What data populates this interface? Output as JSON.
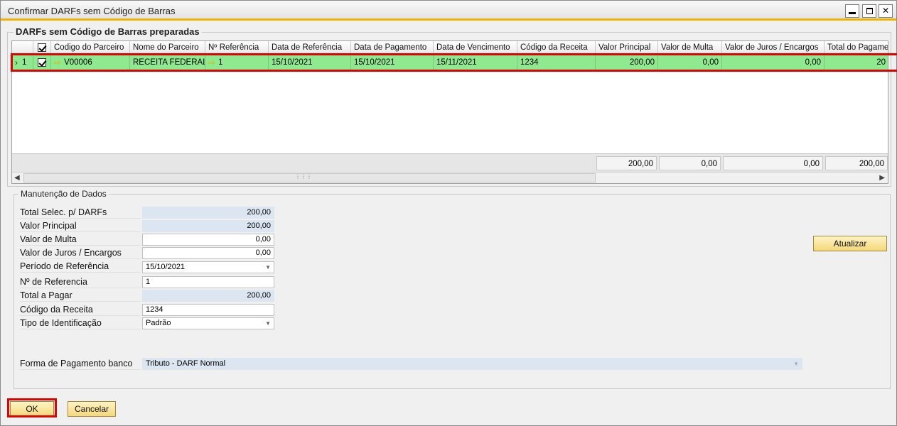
{
  "window": {
    "title": "Confirmar DARFs sem Código de Barras"
  },
  "grid": {
    "group_title": "DARFs sem Código de Barras preparadas",
    "columns": [
      "Codigo do Parceiro",
      "Nome do Parceiro",
      "Nº Referência",
      "Data de Referência",
      "Data de Pagamento",
      "Data de Vencimento",
      "Código da Receita",
      "Valor Principal",
      "Valor de Multa",
      "Valor de Juros / Encargos",
      "Total do Pagamen"
    ],
    "row": {
      "index": "1",
      "codigo_parceiro": "V00006",
      "nome_parceiro": "RECEITA FEDERAL",
      "referencia": "1",
      "data_referencia": "15/10/2021",
      "data_pagamento": "15/10/2021",
      "data_vencimento": "15/11/2021",
      "codigo_receita": "1234",
      "valor_principal": "200,00",
      "valor_multa": "0,00",
      "valor_juros": "0,00",
      "total": "20"
    },
    "totals": {
      "valor_principal": "200,00",
      "valor_multa": "0,00",
      "valor_juros": "0,00",
      "total": "200,00"
    }
  },
  "form": {
    "group_title": "Manutenção de Dados",
    "total_selec_label": "Total Selec. p/ DARFs",
    "total_selec_value": "200,00",
    "valor_principal_label": "Valor Principal",
    "valor_principal_value": "200,00",
    "valor_multa_label": "Valor de Multa",
    "valor_multa_value": "0,00",
    "valor_juros_label": "Valor de Juros / Encargos",
    "valor_juros_value": "0,00",
    "periodo_label": "Período de Referência",
    "periodo_value": "15/10/2021",
    "referencia_label": "Nº de Referencia",
    "referencia_value": "1",
    "total_pagar_label": "Total a Pagar",
    "total_pagar_value": "200,00",
    "codigo_receita_label": "Código da Receita",
    "codigo_receita_value": "1234",
    "tipo_ident_label": "Tipo de Identificação",
    "tipo_ident_value": "Padrão",
    "forma_pagamento_label": "Forma de Pagamento banco",
    "forma_pagamento_value": "Tributo - DARF Normal",
    "atualizar_label": "Atualizar"
  },
  "footer": {
    "ok_label": "OK",
    "cancel_label": "Cancelar"
  },
  "colors": {
    "selected_row": "#8fe98f",
    "highlight_box": "#e00000",
    "title_accent": "#f0b400",
    "readonly_field": "#dce6f1"
  }
}
